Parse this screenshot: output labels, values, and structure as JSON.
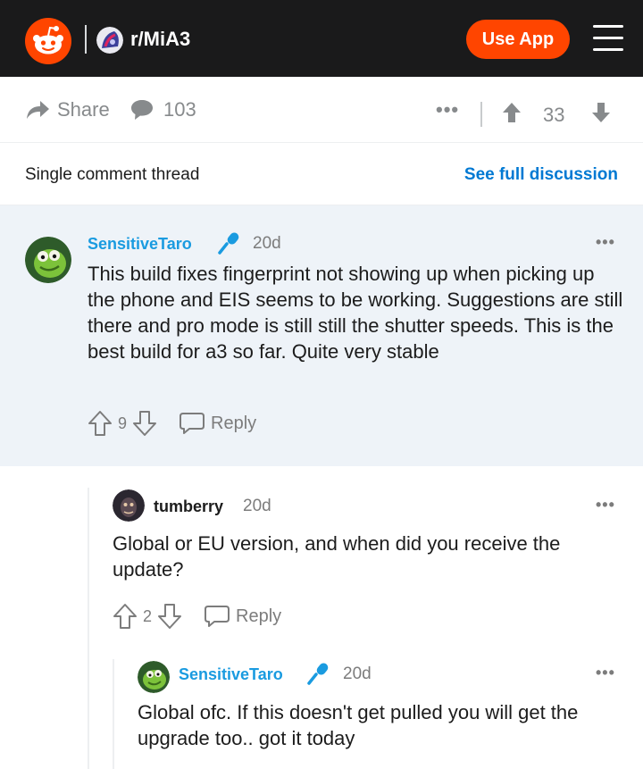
{
  "header": {
    "subreddit": "r/MiA3",
    "use_app_label": "Use App"
  },
  "actionbar": {
    "share_label": "Share",
    "comment_count": "103",
    "more_label": "•••",
    "score": "33"
  },
  "thread": {
    "title": "Single comment thread",
    "full_discussion_label": "See full discussion"
  },
  "comments": [
    {
      "author": "SensitiveTaro",
      "age": "20d",
      "text": "This build fixes fingerprint not showing up when picking up the phone and EIS seems to be working. Suggestions are still there and pro mode is still still the shutter speeds. This is the best build for a3 so far. Quite very stable",
      "votes": "9",
      "reply_label": "Reply",
      "more_label": "•••"
    },
    {
      "author": "tumberry",
      "age": "20d",
      "text": "Global or EU version, and when did you receive the update?",
      "votes": "2",
      "reply_label": "Reply",
      "more_label": "•••"
    },
    {
      "author": "SensitiveTaro",
      "age": "20d",
      "text": "Global ofc. If this doesn't get pulled you will get the upgrade too.. got it today",
      "more_label": "•••"
    }
  ],
  "colors": {
    "brand": "#ff4500",
    "header_bg": "#1a1a1b",
    "op_accent": "#1a9be0",
    "link": "#0079d3",
    "highlight_bg": "#eef3f8"
  },
  "icons": [
    "reddit-logo-icon",
    "share-icon",
    "comment-icon",
    "upvote-icon",
    "downvote-icon",
    "menu-icon",
    "microphone-icon",
    "reply-icon"
  ]
}
